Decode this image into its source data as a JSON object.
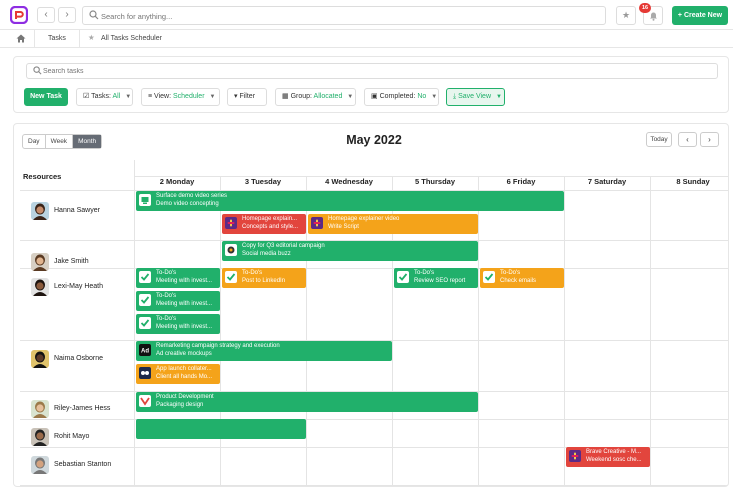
{
  "topbar": {
    "search_placeholder": "Search for anything...",
    "notification_count": "16",
    "create_label": "+ Create New"
  },
  "breadcrumb": {
    "items": [
      "Tasks",
      "All Tasks Scheduler"
    ]
  },
  "filters": {
    "search_placeholder": "Search tasks",
    "new_task": "New Task",
    "tasks_label": "Tasks:",
    "tasks_value": "All",
    "view_label": "View:",
    "view_value": "Scheduler",
    "filter_label": "Filter",
    "group_label": "Group:",
    "group_value": "Allocated",
    "completed_label": "Completed:",
    "completed_value": "No",
    "save_view": "Save View"
  },
  "scheduler": {
    "views": [
      "Day",
      "Week",
      "Month"
    ],
    "active_view": "Month",
    "title": "May 2022",
    "today": "Today",
    "resources_header": "Resources",
    "days": [
      "2 Monday",
      "3 Tuesday",
      "4 Wednesday",
      "5 Thursday",
      "6 Friday",
      "7 Saturday",
      "8 Sunday"
    ],
    "resources": [
      {
        "name": "Hanna Sawyer",
        "avatar": "avatar-female"
      },
      {
        "name": "Jake Smith",
        "avatar": "avatar-male"
      },
      {
        "name": "Lexi-May Heath",
        "avatar": "avatar-female"
      },
      {
        "name": "Naima Osborne",
        "avatar": "avatar-female"
      },
      {
        "name": "Riley-James Hess",
        "avatar": "avatar-male"
      },
      {
        "name": "Rohit Mayo",
        "avatar": "avatar-male"
      },
      {
        "name": "Sebastian Stanton",
        "avatar": "avatar-male"
      }
    ],
    "events": [
      {
        "title": "Surface demo video series",
        "subtitle": "Demo video concepting",
        "color": "green",
        "icon": "surface-logo-icon"
      },
      {
        "title": "Homepage explain...",
        "subtitle": "Concepts and style...",
        "color": "red",
        "icon": "slack-icon"
      },
      {
        "title": "Homepage explainer video",
        "subtitle": "Write Script",
        "color": "orange",
        "icon": "slack-icon"
      },
      {
        "title": "Copy for Q3 editorial campaign",
        "subtitle": "Social media buzz",
        "color": "green",
        "icon": "campaign-icon"
      },
      {
        "title": "To-Do's",
        "subtitle": "Meeting with invest...",
        "color": "green",
        "icon": "checkbox-icon"
      },
      {
        "title": "To-Do's",
        "subtitle": "Post to LinkedIn",
        "color": "orange",
        "icon": "checkbox-icon"
      },
      {
        "title": "To-Do's",
        "subtitle": "Review SEO report",
        "color": "green",
        "icon": "checkbox-icon"
      },
      {
        "title": "To-Do's",
        "subtitle": "Check emails",
        "color": "orange",
        "icon": "checkbox-icon"
      },
      {
        "title": "To-Do's",
        "subtitle": "Meeting with invest...",
        "color": "green",
        "icon": "checkbox-icon"
      },
      {
        "title": "To-Do's",
        "subtitle": "Meeting with invest...",
        "color": "green",
        "icon": "checkbox-icon"
      },
      {
        "title": "Remarketing campaign strategy and execution",
        "subtitle": "Ad creative mockups",
        "color": "green",
        "icon": "ad-icon"
      },
      {
        "title": "App launch collater...",
        "subtitle": "Client all hands Mo...",
        "color": "orange",
        "icon": "app-icon"
      },
      {
        "title": "Product Development",
        "subtitle": "Packaging design",
        "color": "green",
        "icon": "product-logo-icon"
      },
      {
        "title": "",
        "subtitle": "",
        "color": "green",
        "icon": ""
      },
      {
        "title": "Brave Creative - M...",
        "subtitle": "Weekend sosc che...",
        "color": "red",
        "icon": "slack-icon"
      }
    ]
  },
  "colors": {
    "green": "#21b06b",
    "orange": "#f4a31a",
    "red": "#e2453d",
    "badge": "#e53935"
  }
}
